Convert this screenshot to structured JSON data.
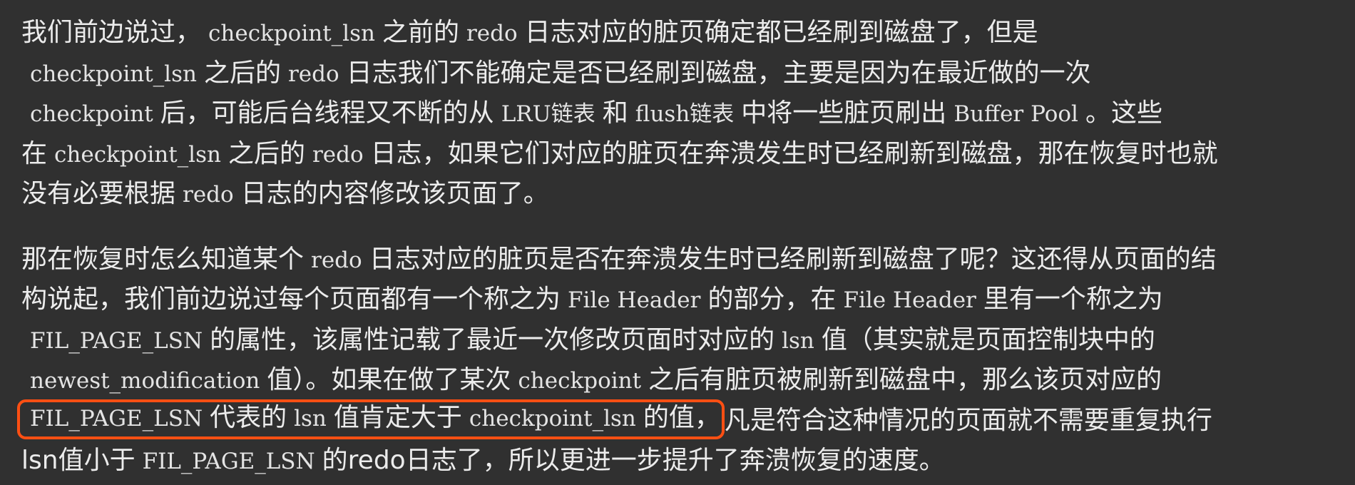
{
  "p1": {
    "l1": [
      "我们前边说过，",
      "checkpoint_lsn",
      "之前的",
      "redo",
      "日志对应的脏页确定都已经刷到磁盘了，但是"
    ],
    "l2": [
      "checkpoint_lsn",
      "之后的",
      "redo",
      "日志我们不能确定是否已经刷到磁盘，主要是因为在最近做的一次"
    ],
    "l3": [
      "checkpoint",
      "后，可能后台线程又不断的从",
      "LRU链表",
      "和",
      "flush链表",
      "中将一些脏页刷出",
      "Buffer Pool",
      "。这些"
    ],
    "l4": [
      "在",
      "checkpoint_lsn",
      "之后的",
      "redo",
      "日志，如果它们对应的脏页在奔溃发生时已经刷新到磁盘，那在恢复时也就"
    ],
    "l5": [
      "没有必要根据",
      "redo",
      "日志的内容修改该页面了。"
    ]
  },
  "p2": {
    "l1": [
      "那在恢复时怎么知道某个",
      "redo",
      "日志对应的脏页是否在奔溃发生时已经刷新到磁盘了呢？这还得从页面的结"
    ],
    "l2": [
      "构说起，我们前边说过每个页面都有一个称之为",
      "File Header",
      "的部分，在",
      "File Header",
      "里有一个称之为"
    ],
    "l3": [
      "FIL_PAGE_LSN",
      "的属性，该属性记载了最近一次修改页面时对应的",
      "lsn",
      "值（其实就是页面控制块中的"
    ],
    "l4": [
      "newest_modification",
      "值）。如果在做了某次",
      "checkpoint",
      "之后有脏页被刷新到磁盘中，那么该页对应的"
    ],
    "l5": [
      "FIL_PAGE_LSN",
      "代表的",
      "lsn",
      "值肯定大于",
      "checkpoint_lsn",
      "的值，",
      "凡是符合这种情况的页面就不需要重复执行"
    ],
    "l6": [
      "lsn值小于",
      "FIL_PAGE_LSN",
      "的redo日志了，所以更进一步提升了奔溃恢复的速度。"
    ]
  },
  "colors": {
    "background": "#303030",
    "text": "#ececec",
    "highlight_border": "#ff4f13"
  }
}
